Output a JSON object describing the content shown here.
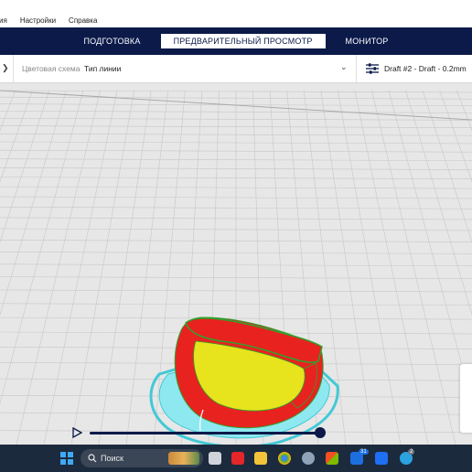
{
  "menu": {
    "items": [
      "ия",
      "Настройки",
      "Справка"
    ]
  },
  "stages": [
    {
      "label": "ПОДГОТОВКА",
      "active": false
    },
    {
      "label": "ПРЕДВАРИТЕЛЬНЫЙ ПРОСМОТР",
      "active": true
    },
    {
      "label": "МОНИТОР",
      "active": false
    }
  ],
  "toolbar": {
    "color_scheme_label": "Цветовая схема",
    "color_scheme_value": "Тип линии",
    "profile": "Draft #2 - Draft - 0.2mm"
  },
  "viewport": {
    "colors": {
      "background": "#e7e7e7",
      "grid": "#c7c7c7",
      "wall_outer": "#e8221f",
      "infill": "#e7e31c",
      "support": "#8ee8f0",
      "skirt": "#42c9d6",
      "wall_inner": "#2fa22f"
    }
  },
  "playback": {
    "layer_progress": 1.0
  },
  "taskbar": {
    "search_placeholder": "Поиск",
    "icons": [
      "windows-icon",
      "task-view-icon",
      "youtube-icon",
      "file-explorer-icon",
      "chrome-icon",
      "settings-icon",
      "store-icon",
      "outlook-icon",
      "cura-icon",
      "telegram-icon"
    ],
    "outlook_badge": "31",
    "telegram_badge": "2"
  },
  "colors": {
    "accent": "#0b1a49",
    "taskbar": "#1c2a3e"
  }
}
